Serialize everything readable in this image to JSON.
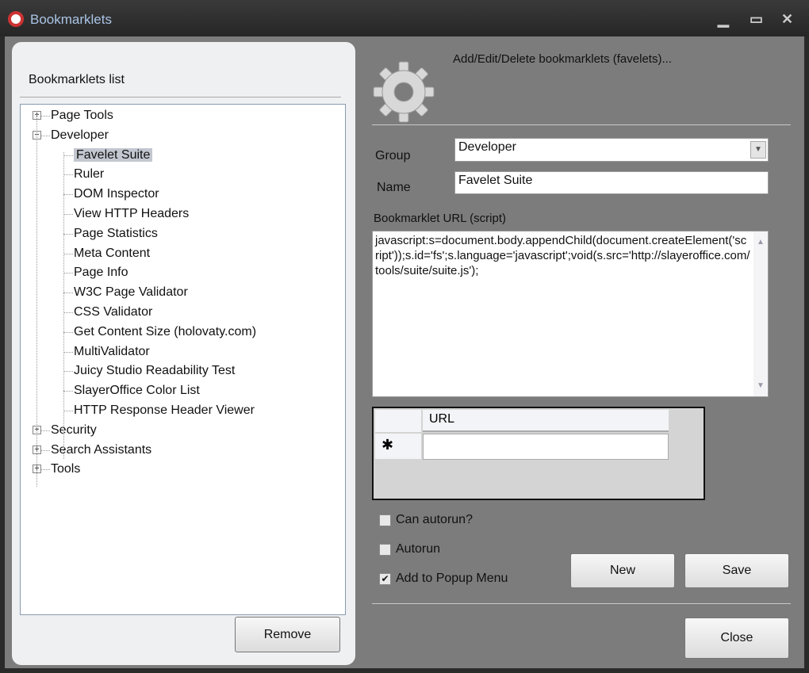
{
  "window": {
    "title": "Bookmarklets",
    "minimize": "▁",
    "maximize": "▭",
    "close": "✕"
  },
  "left": {
    "title": "Bookmarklets list",
    "remove": "Remove",
    "tree": [
      {
        "label": "Page Tools",
        "level": 0,
        "expander": "+"
      },
      {
        "label": "Developer",
        "level": 0,
        "expander": "−"
      },
      {
        "label": "Favelet Suite",
        "level": 1,
        "selected": true
      },
      {
        "label": "Ruler",
        "level": 1
      },
      {
        "label": "DOM Inspector",
        "level": 1
      },
      {
        "label": "View HTTP Headers",
        "level": 1
      },
      {
        "label": "Page Statistics",
        "level": 1
      },
      {
        "label": "Meta Content",
        "level": 1
      },
      {
        "label": "Page Info",
        "level": 1
      },
      {
        "label": "W3C Page Validator",
        "level": 1
      },
      {
        "label": "CSS Validator",
        "level": 1
      },
      {
        "label": "Get Content Size (holovaty.com)",
        "level": 1
      },
      {
        "label": "MultiValidator",
        "level": 1
      },
      {
        "label": "Juicy Studio Readability Test",
        "level": 1
      },
      {
        "label": "SlayerOffice Color List",
        "level": 1
      },
      {
        "label": "HTTP Response Header Viewer",
        "level": 1
      },
      {
        "label": "Security",
        "level": 0,
        "expander": "+"
      },
      {
        "label": "Search Assistants",
        "level": 0,
        "expander": "+"
      },
      {
        "label": "Tools",
        "level": 0,
        "expander": "+"
      }
    ]
  },
  "right": {
    "header": "Add/Edit/Delete bookmarklets (favelets)...",
    "group_label": "Group",
    "group_value": "Developer",
    "name_label": "Name",
    "name_value": "Favelet Suite",
    "url_label": "Bookmarklet URL (script)",
    "url_value": "javascript:s=document.body.appendChild(document.createElement('script'));s.id='fs';s.language='javascript';void(s.src='http://slayeroffice.com/tools/suite/suite.js');",
    "grid_header": "URL",
    "grid_new_row": "✱",
    "can_autorun": "Can autorun?",
    "autorun": "Autorun",
    "add_popup": "Add to Popup Menu",
    "can_autorun_checked": false,
    "autorun_checked": false,
    "add_popup_checked": true,
    "check_mark": "✔",
    "new": "New",
    "save": "Save",
    "close": "Close"
  }
}
